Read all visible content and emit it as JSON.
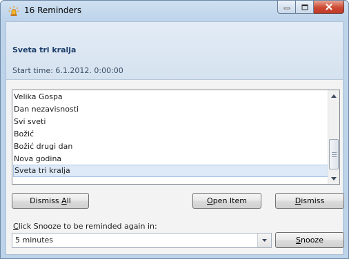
{
  "window": {
    "title": "16 Reminders",
    "icon": "reminder-bell-icon"
  },
  "header": {
    "subject": "Sveta tri kralja",
    "start_time": "Start time: 6.1.2012. 0:00:00"
  },
  "reminders": {
    "items": [
      {
        "label": "Velika Gospa"
      },
      {
        "label": "Dan nezavisnosti"
      },
      {
        "label": "Svi sveti"
      },
      {
        "label": "Božić"
      },
      {
        "label": "Božić drugi dan"
      },
      {
        "label": "Nova godina"
      },
      {
        "label": "Sveta tri kralja",
        "selected": true
      }
    ]
  },
  "buttons": {
    "dismiss_all": {
      "pre": "Dismiss ",
      "mn": "A",
      "post": "ll"
    },
    "open_item": {
      "pre": "",
      "mn": "O",
      "post": "pen Item"
    },
    "dismiss": {
      "pre": "",
      "mn": "D",
      "post": "ismiss"
    },
    "snooze": {
      "pre": "",
      "mn": "S",
      "post": "nooze"
    }
  },
  "snooze": {
    "hint": {
      "mn": "C",
      "post": "lick Snooze to be reminded again in:"
    },
    "selected_value": "5 minutes"
  },
  "colors": {
    "accent": "#1a3c68",
    "selection": "#dde9f7",
    "close_button": "#c0392b"
  }
}
